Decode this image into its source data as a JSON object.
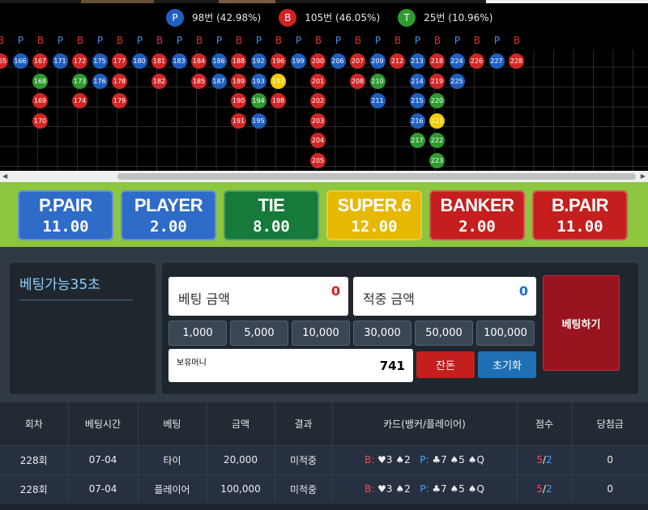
{
  "stats": {
    "player": {
      "badge": "P",
      "text": "98번 (42.98%)",
      "color": "#1f5fbf"
    },
    "banker": {
      "badge": "B",
      "text": "105번 (46.05%)",
      "color": "#d22222"
    },
    "tie": {
      "badge": "T",
      "text": "25번 (10.96%)",
      "color": "#2f9a2f"
    }
  },
  "road": {
    "header": [
      "B",
      "P",
      "B",
      "P",
      "B",
      "P",
      "B",
      "P",
      "B",
      "P",
      "B",
      "P",
      "B",
      "P",
      "B",
      "P",
      "B",
      "P",
      "B",
      "P",
      "B",
      "P",
      "B",
      "P",
      "B",
      "P",
      "B"
    ],
    "columns": [
      [
        {
          "n": "165",
          "c": "r"
        }
      ],
      [
        {
          "n": "166",
          "c": "b"
        }
      ],
      [
        {
          "n": "167",
          "c": "r"
        },
        {
          "n": "168",
          "c": "g"
        },
        {
          "n": "169",
          "c": "r"
        },
        {
          "n": "170",
          "c": "r"
        }
      ],
      [
        {
          "n": "171",
          "c": "b"
        }
      ],
      [
        {
          "n": "172",
          "c": "r"
        },
        {
          "n": "173",
          "c": "g"
        },
        {
          "n": "174",
          "c": "r"
        }
      ],
      [
        {
          "n": "175",
          "c": "b"
        },
        {
          "n": "176",
          "c": "b"
        }
      ],
      [
        {
          "n": "177",
          "c": "r"
        },
        {
          "n": "178",
          "c": "r"
        },
        {
          "n": "179",
          "c": "r"
        }
      ],
      [
        {
          "n": "180",
          "c": "b"
        }
      ],
      [
        {
          "n": "181",
          "c": "r"
        },
        {
          "n": "182",
          "c": "r"
        }
      ],
      [
        {
          "n": "183",
          "c": "b"
        }
      ],
      [
        {
          "n": "184",
          "c": "r"
        },
        {
          "n": "185",
          "c": "r"
        }
      ],
      [
        {
          "n": "186",
          "c": "b"
        },
        {
          "n": "187",
          "c": "b"
        }
      ],
      [
        {
          "n": "188",
          "c": "r"
        },
        {
          "n": "189",
          "c": "r"
        },
        {
          "n": "190",
          "c": "r"
        },
        {
          "n": "191",
          "c": "r"
        }
      ],
      [
        {
          "n": "192",
          "c": "b"
        },
        {
          "n": "193",
          "c": "b"
        },
        {
          "n": "194",
          "c": "g"
        },
        {
          "n": "195",
          "c": "b"
        }
      ],
      [
        {
          "n": "196",
          "c": "r"
        },
        {
          "n": "197",
          "c": "y"
        },
        {
          "n": "198",
          "c": "r"
        }
      ],
      [
        {
          "n": "199",
          "c": "b"
        }
      ],
      [
        {
          "n": "200",
          "c": "r"
        },
        {
          "n": "201",
          "c": "r"
        },
        {
          "n": "202",
          "c": "r"
        },
        {
          "n": "203",
          "c": "r"
        },
        {
          "n": "204",
          "c": "r"
        },
        {
          "n": "205",
          "c": "r"
        }
      ],
      [
        {
          "n": "206",
          "c": "b"
        }
      ],
      [
        {
          "n": "207",
          "c": "r"
        },
        {
          "n": "208",
          "c": "r"
        }
      ],
      [
        {
          "n": "209",
          "c": "b"
        },
        {
          "n": "210",
          "c": "g"
        },
        {
          "n": "211",
          "c": "b"
        }
      ],
      [
        {
          "n": "212",
          "c": "r"
        }
      ],
      [
        {
          "n": "213",
          "c": "b"
        },
        {
          "n": "214",
          "c": "b"
        },
        {
          "n": "215",
          "c": "b"
        },
        {
          "n": "216",
          "c": "b"
        },
        {
          "n": "217",
          "c": "g"
        }
      ],
      [
        {
          "n": "218",
          "c": "r"
        },
        {
          "n": "219",
          "c": "r"
        },
        {
          "n": "220",
          "c": "g"
        },
        {
          "n": "221",
          "c": "y"
        },
        {
          "n": "222",
          "c": "g"
        },
        {
          "n": "223",
          "c": "g"
        }
      ],
      [
        {
          "n": "224",
          "c": "b"
        },
        {
          "n": "225",
          "c": "b"
        }
      ],
      [
        {
          "n": "226",
          "c": "r"
        }
      ],
      [
        {
          "n": "227",
          "c": "b"
        }
      ],
      [
        {
          "n": "228",
          "c": "r"
        }
      ]
    ]
  },
  "odds": [
    {
      "label": "P.PAIR",
      "value": "11.00",
      "color": "#2f6bc9"
    },
    {
      "label": "PLAYER",
      "value": "2.00",
      "color": "#2f6bc9"
    },
    {
      "label": "TIE",
      "value": "8.00",
      "color": "#157a3a"
    },
    {
      "label": "SUPER.6",
      "value": "12.00",
      "color": "#e6b800"
    },
    {
      "label": "BANKER",
      "value": "2.00",
      "color": "#c41e1e"
    },
    {
      "label": "B.PAIR",
      "value": "11.00",
      "color": "#c41e1e"
    }
  ],
  "bet": {
    "timer": "베팅가능35초",
    "bet_amount_label": "베팅 금액",
    "bet_amount_value": "0",
    "win_amount_label": "적중 금액",
    "win_amount_value": "0",
    "chips": [
      "1,000",
      "5,000",
      "10,000",
      "30,000",
      "50,000",
      "100,000"
    ],
    "balance_label": "보유머니",
    "balance_value": "741",
    "remain_label": "잔돈",
    "reset_label": "초기화",
    "place_label": "베팅하기"
  },
  "history": {
    "headers": [
      "회차",
      "베팅시간",
      "베팅",
      "금액",
      "결과",
      "카드(뱅커/플레이어)",
      "점수",
      "당첨금"
    ],
    "rows": [
      {
        "round": "228회",
        "time": "07-04",
        "bet": "타이",
        "amount": "20,000",
        "result": "미적중",
        "banker_cards": "♥3 ♠2",
        "player_cards": "♣7 ♠5 ♠Q",
        "score_b": "5",
        "score_p": "2",
        "prize": "0"
      },
      {
        "round": "228회",
        "time": "07-04",
        "bet": "플레이어",
        "amount": "100,000",
        "result": "미적중",
        "banker_cards": "♥3 ♠2",
        "player_cards": "♣7 ♠5 ♠Q",
        "score_b": "5",
        "score_p": "2",
        "prize": "0"
      }
    ],
    "card_banker_prefix": "B:",
    "card_player_prefix": "P:"
  }
}
